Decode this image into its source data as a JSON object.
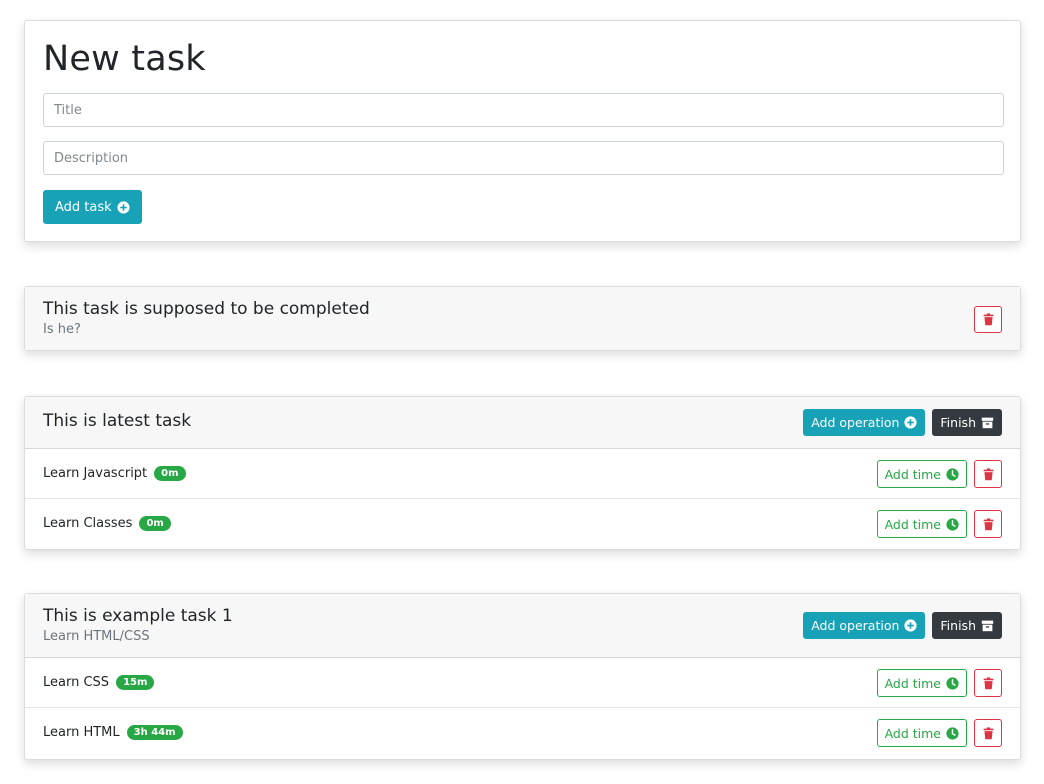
{
  "new_task": {
    "heading": "New task",
    "title_placeholder": "Title",
    "description_placeholder": "Description",
    "add_button_label": "Add task",
    "add_button_icon": "plus-circle-icon"
  },
  "colors": {
    "info": "#17a2b8",
    "dark": "#343a40",
    "success": "#28a745",
    "danger": "#dc3545"
  },
  "labels": {
    "add_operation": "Add operation",
    "finish": "Finish",
    "add_time": "Add time"
  },
  "tasks": [
    {
      "title": "This task is supposed to be completed",
      "description": "Is he?",
      "completed": true,
      "operations": []
    },
    {
      "title": "This is latest task",
      "description": "",
      "completed": false,
      "operations": [
        {
          "name": "Learn Javascript",
          "time": "0m"
        },
        {
          "name": "Learn Classes",
          "time": "0m"
        }
      ]
    },
    {
      "title": "This is example task 1",
      "description": "Learn HTML/CSS",
      "completed": false,
      "operations": [
        {
          "name": "Learn CSS",
          "time": "15m"
        },
        {
          "name": "Learn HTML",
          "time": "3h 44m"
        }
      ]
    }
  ]
}
